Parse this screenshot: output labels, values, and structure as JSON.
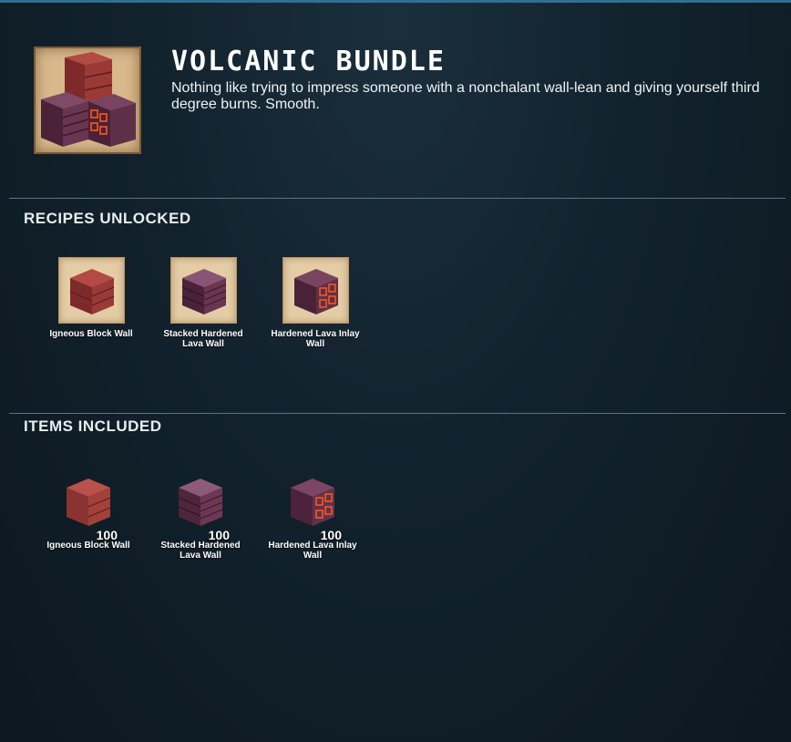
{
  "bundle": {
    "title": "VOLCANIC BUNDLE",
    "description": "Nothing like trying to impress someone with a nonchalant wall-lean and giving yourself third degree burns. Smooth.",
    "icon": "volcanic-bundle-icon"
  },
  "recipes": {
    "heading": "RECIPES UNLOCKED",
    "items": [
      {
        "label": "Igneous Block Wall",
        "icon": "igneous-block-wall-icon"
      },
      {
        "label": "Stacked Hardened Lava Wall",
        "icon": "stacked-hardened-lava-wall-icon"
      },
      {
        "label": "Hardened Lava Inlay Wall",
        "icon": "hardened-lava-inlay-wall-icon"
      }
    ]
  },
  "included": {
    "heading": "ITEMS INCLUDED",
    "items": [
      {
        "label": "Igneous Block Wall",
        "quantity": "100",
        "icon": "igneous-block-wall-icon"
      },
      {
        "label": "Stacked Hardened Lava Wall",
        "quantity": "100",
        "icon": "stacked-hardened-lava-wall-icon"
      },
      {
        "label": "Hardened Lava Inlay Wall",
        "quantity": "100",
        "icon": "hardened-lava-inlay-wall-icon"
      }
    ]
  },
  "colors": {
    "background": "#0f1d26",
    "accent_border": "#2f6f92",
    "parchment": "#e4cda6",
    "igneous": "#9a3a36",
    "stacked": "#6a3550",
    "inlay": "#5e3048",
    "lava_glow": "#ff5a1a"
  }
}
